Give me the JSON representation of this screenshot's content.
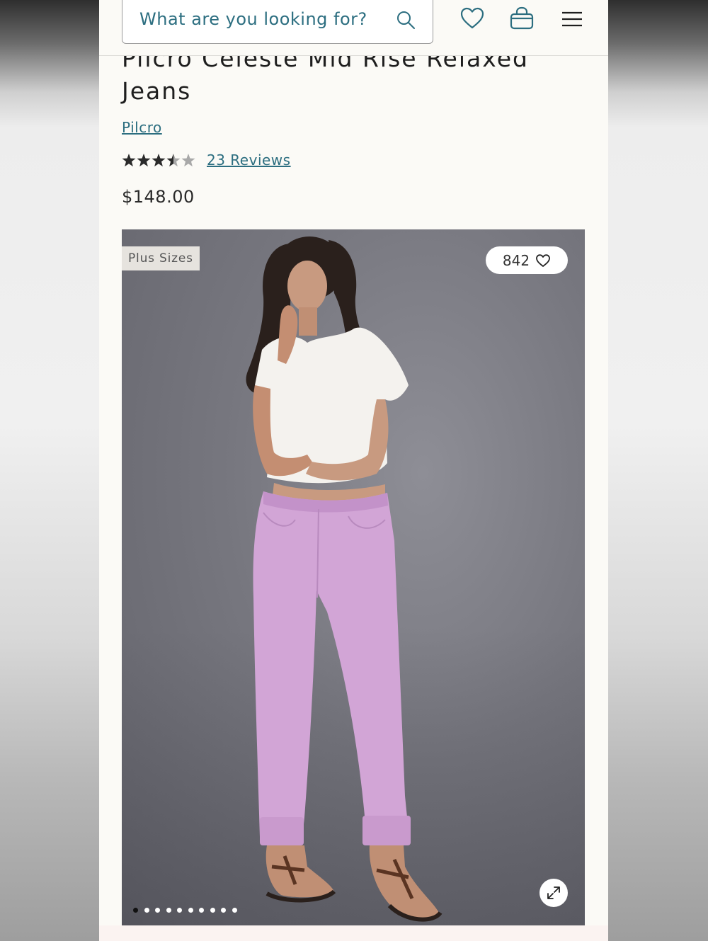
{
  "header": {
    "search_placeholder": "What are you looking for?",
    "icons": [
      "search-icon",
      "heart-icon",
      "shopping-bag-icon",
      "hamburger-menu-icon"
    ]
  },
  "product": {
    "title": "Pilcro Celeste Mid Rise Relaxed Jeans",
    "brand": "Pilcro",
    "rating": 3.5,
    "rating_max": 5,
    "reviews_label": "23 Reviews",
    "price": "$148.00"
  },
  "gallery": {
    "badge": "Plus Sizes",
    "likes_count": "842",
    "image_count": 10,
    "active_index": 0
  },
  "colors": {
    "accent": "#2c6e80",
    "jeans": "#d2a5d6",
    "backdrop": "#77777f"
  }
}
